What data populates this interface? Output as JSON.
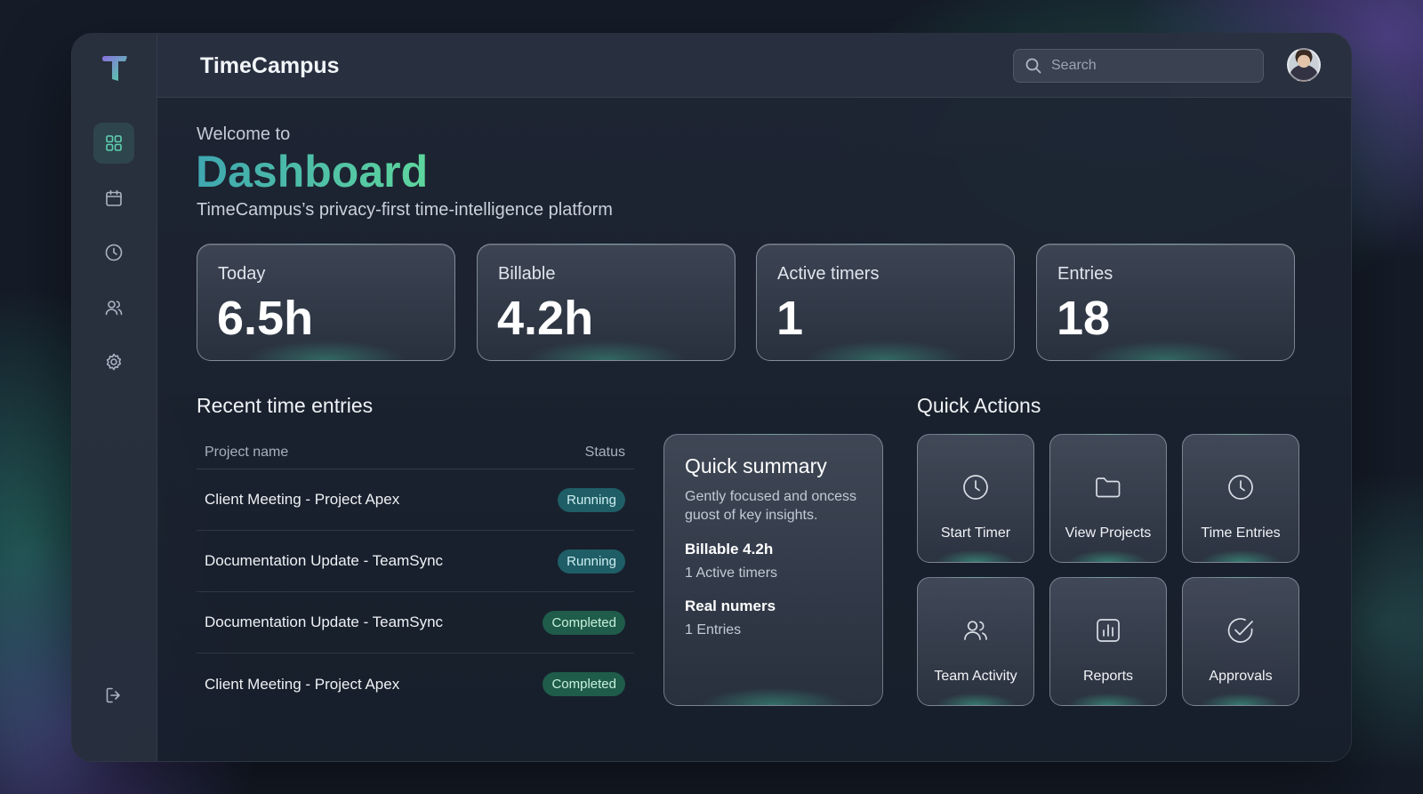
{
  "app": {
    "title": "TimeCampus"
  },
  "search": {
    "placeholder": "Search"
  },
  "sidebar": {
    "items": [
      {
        "icon": "dashboard-grid-icon",
        "active": true
      },
      {
        "icon": "calendar-icon",
        "active": false
      },
      {
        "icon": "clock-icon",
        "active": false
      },
      {
        "icon": "users-icon",
        "active": false
      },
      {
        "icon": "gear-icon",
        "active": false
      }
    ],
    "logout_icon": "logout-icon"
  },
  "hero": {
    "welcome": "Welcome to",
    "title": "Dashboard",
    "subtitle": "TimeCampus’s privacy-first time-intelligence platform"
  },
  "stats": [
    {
      "label": "Today",
      "value": "6.5h"
    },
    {
      "label": "Billable",
      "value": "4.2h"
    },
    {
      "label": "Active timers",
      "value": "1"
    },
    {
      "label": "Entries",
      "value": "18"
    }
  ],
  "recent": {
    "title": "Recent time entries",
    "columns": {
      "project": "Project name",
      "status": "Status"
    },
    "rows": [
      {
        "project": "Client Meeting - Project Apex",
        "status": "Running"
      },
      {
        "project": "Documentation Update - TeamSync",
        "status": "Running"
      },
      {
        "project": "Documentation Update - TeamSync",
        "status": "Completed"
      },
      {
        "project": "Client Meeting - Project Apex",
        "status": "Completed"
      }
    ]
  },
  "summary": {
    "title": "Quick summary",
    "description": "Gently focused and oncess guost of key insights.",
    "billable_heading": "Billable 4.2h",
    "billable_sub": "1 Active timers",
    "numbers_heading": "Real numers",
    "numbers_sub": "1 Entries"
  },
  "quick_actions": {
    "title": "Quick Actions",
    "items": [
      {
        "label": "Start Timer",
        "icon": "clock-icon"
      },
      {
        "label": "View Projects",
        "icon": "folder-icon"
      },
      {
        "label": "Time Entries",
        "icon": "clock-icon"
      },
      {
        "label": "Team Activity",
        "icon": "users-icon"
      },
      {
        "label": "Reports",
        "icon": "bar-chart-icon"
      },
      {
        "label": "Approvals",
        "icon": "check-circle-icon"
      }
    ]
  },
  "colors": {
    "accent": "#5fd0b0",
    "running_badge": "#1f5e66",
    "completed_badge": "#1f5c4a"
  }
}
